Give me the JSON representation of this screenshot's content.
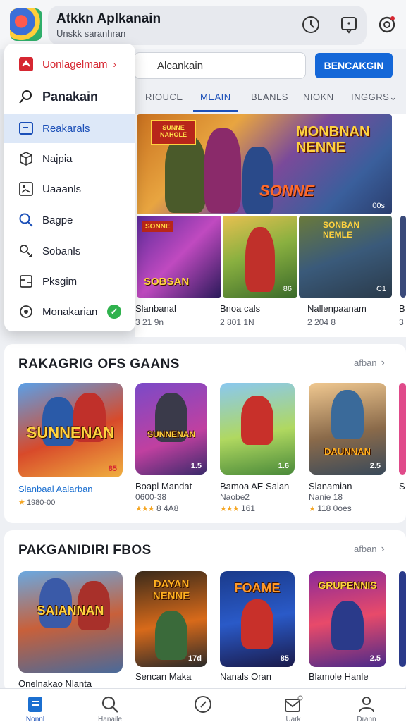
{
  "header": {
    "title": "Atkkn Aplkanain",
    "subtitle": "Unskk saranhran"
  },
  "menu": {
    "items": [
      {
        "label": "Uonlagelmam",
        "icon": "store-logo-icon",
        "chevron": "›"
      },
      {
        "label": "Panakain",
        "icon": "search-icon"
      },
      {
        "label": "Reakarals",
        "icon": "folder-icon"
      },
      {
        "label": "Najpia",
        "icon": "cube-icon"
      },
      {
        "label": "Uaaanls",
        "icon": "image-icon"
      },
      {
        "label": "Bagpe",
        "icon": "search-icon"
      },
      {
        "label": "Sobanls",
        "icon": "link-icon"
      },
      {
        "label": "Pksgim",
        "icon": "document-icon"
      },
      {
        "label": "Monakarian",
        "icon": "disc-icon",
        "check": "✓"
      }
    ]
  },
  "search": {
    "value": "Alcankain",
    "button": "BENCAKGIN"
  },
  "tabs": [
    {
      "label": "RIOUCE"
    },
    {
      "label": "MEAIN"
    },
    {
      "label": "BLANLS"
    },
    {
      "label": "NIOKN"
    },
    {
      "label": "INGGRS⌄"
    }
  ],
  "hero": {
    "badge": "SUNNE NAHOLE",
    "title": "MONBNAN NENNE",
    "subtitle": "SONNE",
    "count": "00s"
  },
  "thumbs": [
    {
      "label": "SOBSAN",
      "count": "",
      "badge": "SONNE"
    },
    {
      "label": "",
      "count": "86"
    },
    {
      "label": "SONBAN NEMLE",
      "count": "C1"
    }
  ],
  "featured_games": [
    {
      "name": "Slanbanal",
      "meta": "3 21 9n"
    },
    {
      "name": "Bnoa cals",
      "meta": "2 801 1N"
    },
    {
      "name": "Nallenpaanam",
      "meta": "2 204 8"
    },
    {
      "name": "B",
      "meta": "3"
    }
  ],
  "section1": {
    "title": "RAKAGRIG OFS GAANS",
    "see_all": "afban",
    "cards": [
      {
        "art": "SUNNENAN",
        "count": "85",
        "name": "Slanbaal Aalarban",
        "meta": "1980-00",
        "rating": "★"
      },
      {
        "art": "SUNNENAN",
        "count": "1.5",
        "name": "Boapl Mandat",
        "meta": "0600-38",
        "rating": "★★★",
        "rating_text": "8 4A8"
      },
      {
        "art": "",
        "count": "1.6",
        "name": "Bamoa AE Salan",
        "meta": "Naobe2",
        "rating": "★★★",
        "rating_text": "161"
      },
      {
        "art": "DAUNNAN",
        "count": "2.5",
        "name": "Slanamian",
        "meta": "Nanie 18",
        "rating": "★",
        "rating_text": "118 0oes"
      },
      {
        "art": "",
        "count": "",
        "name": "S",
        "meta": ""
      }
    ]
  },
  "section2": {
    "title": "PAKGANIDIRI FBOS",
    "see_all": "afban",
    "cards": [
      {
        "art": "SAIANNAN",
        "count": "",
        "name": "Onelnakao Nlanta"
      },
      {
        "art": "DAYAN NENNE",
        "count": "17d",
        "name": "Sencan Maka"
      },
      {
        "art": "FOAME",
        "count": "85",
        "name": "Nanals Oran"
      },
      {
        "art": "GRUPENNIS",
        "count": "2.5",
        "name": "Blamole Hanle"
      }
    ]
  },
  "bottom_nav": [
    {
      "label": "Nonnl",
      "icon": "home-icon"
    },
    {
      "label": "Hanaile",
      "icon": "search-icon"
    },
    {
      "label": "",
      "icon": "compass-icon"
    },
    {
      "label": "Uark",
      "icon": "inbox-icon"
    },
    {
      "label": "Drann",
      "icon": "profile-icon"
    }
  ],
  "colors": {
    "accent": "#1467d8",
    "brand_red": "#d62731",
    "active_menu_bg": "#dde8f8",
    "check_green": "#2fb24d",
    "star": "#f5a623"
  }
}
